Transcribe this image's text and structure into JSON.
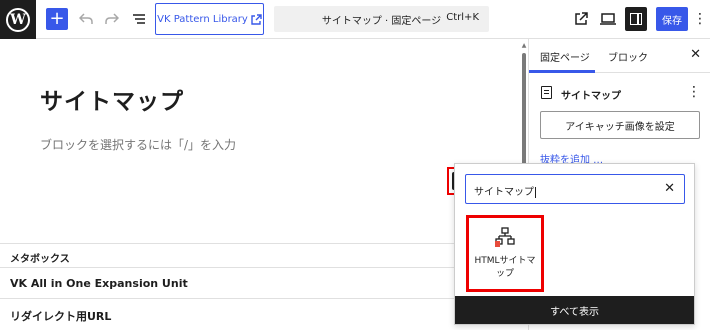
{
  "header": {
    "logo_letter": "W",
    "add_block_glyph": "+",
    "vk_button_label": "VK Pattern Library",
    "document_title": "サイトマップ · 固定ページ",
    "shortcut": "Ctrl+K",
    "save_label": "保存",
    "icons": [
      "wordpress-logo",
      "plus-icon",
      "undo-icon",
      "redo-icon",
      "document-overview-icon",
      "external-link-icon",
      "view-icon",
      "settings-icon",
      "more-vertical-icon"
    ]
  },
  "editor": {
    "title": "サイトマップ",
    "placeholder": "ブロックを選択するには「/」を入力",
    "inserter_glyph": "+"
  },
  "meta": {
    "header": "メタボックス",
    "rows": [
      "VK All in One Expansion Unit",
      "リダイレクト用URL"
    ]
  },
  "sidebar": {
    "tabs": [
      "固定ページ",
      "ブロック"
    ],
    "active_tab": "固定ページ",
    "doc_title": "サイトマップ",
    "featured_image_button": "アイキャッチ画像を設定",
    "excerpt_link": "抜粋を追加 …"
  },
  "inserter": {
    "search_value": "サイトマップ",
    "result_label": "HTMLサイトマップ",
    "browse_all": "すべて表示"
  },
  "colors": {
    "accent": "#3858e9",
    "dark": "#1e1e1e",
    "highlight": "#e00000"
  }
}
